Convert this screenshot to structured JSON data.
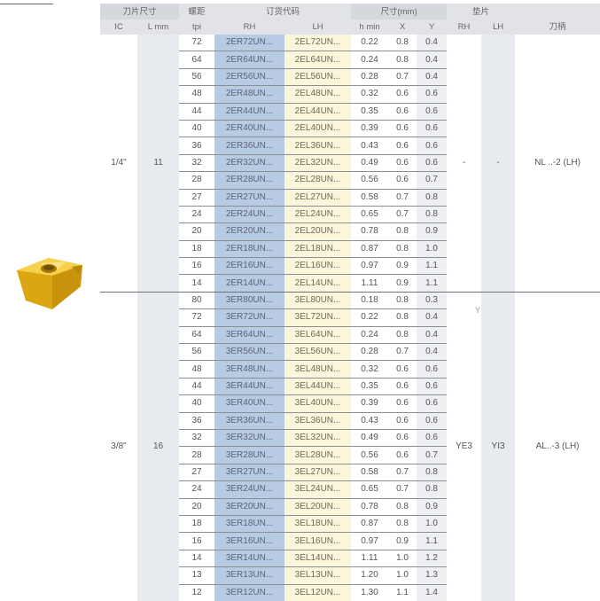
{
  "header": {
    "row1": {
      "insert_size": "刀片尺寸",
      "pitch": "螺距",
      "order_code": "订货代码",
      "dims": "尺寸(mm)",
      "shim": "垫片"
    },
    "row2": {
      "ic": "IC",
      "l": "L mm",
      "tpi": "tpi",
      "rh": "RH",
      "lh": "LH",
      "hmin": "h min",
      "x": "X",
      "y": "Y",
      "shim_rh": "RH",
      "shim_lh": "LH",
      "holder": "刀柄"
    }
  },
  "groups": [
    {
      "ic": "1/4\"",
      "l": "11",
      "shim_rh": "-",
      "shim_lh": "-",
      "holder": "NL ..-2 (LH)",
      "rows": [
        {
          "tpi": "72",
          "rh": "2ER72UN...",
          "lh": "2EL72UN...",
          "h": "0.22",
          "x": "0.8",
          "y": "0.4"
        },
        {
          "tpi": "64",
          "rh": "2ER64UN...",
          "lh": "2EL64UN...",
          "h": "0.24",
          "x": "0.8",
          "y": "0.4"
        },
        {
          "tpi": "56",
          "rh": "2ER56UN...",
          "lh": "2EL56UN...",
          "h": "0.28",
          "x": "0.7",
          "y": "0.4"
        },
        {
          "tpi": "48",
          "rh": "2ER48UN...",
          "lh": "2EL48UN...",
          "h": "0.32",
          "x": "0.6",
          "y": "0.6"
        },
        {
          "tpi": "44",
          "rh": "2ER44UN...",
          "lh": "2EL44UN...",
          "h": "0.35",
          "x": "0.6",
          "y": "0.6"
        },
        {
          "tpi": "40",
          "rh": "2ER40UN...",
          "lh": "2EL40UN...",
          "h": "0.39",
          "x": "0.6",
          "y": "0.6"
        },
        {
          "tpi": "36",
          "rh": "2ER36UN...",
          "lh": "2EL36UN...",
          "h": "0.43",
          "x": "0.6",
          "y": "0.6"
        },
        {
          "tpi": "32",
          "rh": "2ER32UN...",
          "lh": "2EL32UN...",
          "h": "0.49",
          "x": "0.6",
          "y": "0.6"
        },
        {
          "tpi": "28",
          "rh": "2ER28UN...",
          "lh": "2EL28UN...",
          "h": "0.56",
          "x": "0.6",
          "y": "0.7"
        },
        {
          "tpi": "27",
          "rh": "2ER27UN...",
          "lh": "2EL27UN...",
          "h": "0.58",
          "x": "0.7",
          "y": "0.8"
        },
        {
          "tpi": "24",
          "rh": "2ER24UN...",
          "lh": "2EL24UN...",
          "h": "0.65",
          "x": "0.7",
          "y": "0.8"
        },
        {
          "tpi": "20",
          "rh": "2ER20UN...",
          "lh": "2EL20UN...",
          "h": "0.78",
          "x": "0.8",
          "y": "0.9"
        },
        {
          "tpi": "18",
          "rh": "2ER18UN...",
          "lh": "2EL18UN...",
          "h": "0.87",
          "x": "0.8",
          "y": "1.0"
        },
        {
          "tpi": "16",
          "rh": "2ER16UN...",
          "lh": "2EL16UN...",
          "h": "0.97",
          "x": "0.9",
          "y": "1.1"
        },
        {
          "tpi": "14",
          "rh": "2ER14UN...",
          "lh": "2EL14UN...",
          "h": "1.11",
          "x": "0.9",
          "y": "1.1"
        }
      ]
    },
    {
      "ic": "3/8\"",
      "l": "16",
      "shim_rh": "YE3",
      "shim_lh": "YI3",
      "holder": "AL..-3 (LH)",
      "rows": [
        {
          "tpi": "80",
          "rh": "3ER80UN...",
          "lh": "3EL80UN...",
          "h": "0.18",
          "x": "0.8",
          "y": "0.3"
        },
        {
          "tpi": "72",
          "rh": "3ER72UN...",
          "lh": "3EL72UN...",
          "h": "0.22",
          "x": "0.8",
          "y": "0.4"
        },
        {
          "tpi": "64",
          "rh": "3ER64UN...",
          "lh": "3EL64UN...",
          "h": "0.24",
          "x": "0.8",
          "y": "0.4"
        },
        {
          "tpi": "56",
          "rh": "3ER56UN...",
          "lh": "3EL56UN...",
          "h": "0.28",
          "x": "0.7",
          "y": "0.4"
        },
        {
          "tpi": "48",
          "rh": "3ER48UN...",
          "lh": "3EL48UN...",
          "h": "0.32",
          "x": "0.6",
          "y": "0.6"
        },
        {
          "tpi": "44",
          "rh": "3ER44UN...",
          "lh": "3EL44UN...",
          "h": "0.35",
          "x": "0.6",
          "y": "0.6"
        },
        {
          "tpi": "40",
          "rh": "3ER40UN...",
          "lh": "3EL40UN...",
          "h": "0.39",
          "x": "0.6",
          "y": "0.6"
        },
        {
          "tpi": "36",
          "rh": "3ER36UN...",
          "lh": "3EL36UN...",
          "h": "0.43",
          "x": "0.6",
          "y": "0.6"
        },
        {
          "tpi": "32",
          "rh": "3ER32UN...",
          "lh": "3EL32UN...",
          "h": "0.49",
          "x": "0.6",
          "y": "0.6"
        },
        {
          "tpi": "28",
          "rh": "3ER28UN...",
          "lh": "3EL28UN...",
          "h": "0.56",
          "x": "0.6",
          "y": "0.7"
        },
        {
          "tpi": "27",
          "rh": "3ER27UN...",
          "lh": "3EL27UN...",
          "h": "0.58",
          "x": "0.7",
          "y": "0.8"
        },
        {
          "tpi": "24",
          "rh": "3ER24UN...",
          "lh": "3EL24UN...",
          "h": "0.65",
          "x": "0.7",
          "y": "0.8"
        },
        {
          "tpi": "20",
          "rh": "3ER20UN...",
          "lh": "3EL20UN...",
          "h": "0.78",
          "x": "0.8",
          "y": "0.9"
        },
        {
          "tpi": "18",
          "rh": "3ER18UN...",
          "lh": "3EL18UN...",
          "h": "0.87",
          "x": "0.8",
          "y": "1.0"
        },
        {
          "tpi": "16",
          "rh": "3ER16UN...",
          "lh": "3EL16UN...",
          "h": "0.97",
          "x": "0.9",
          "y": "1.1"
        },
        {
          "tpi": "14",
          "rh": "3ER14UN...",
          "lh": "3EL14UN...",
          "h": "1.11",
          "x": "1.0",
          "y": "1.2"
        },
        {
          "tpi": "13",
          "rh": "3ER13UN...",
          "lh": "3EL13UN...",
          "h": "1.20",
          "x": "1.0",
          "y": "1.3"
        },
        {
          "tpi": "12",
          "rh": "3ER12UN...",
          "lh": "3EL12UN...",
          "h": "1.30",
          "x": "1.1",
          "y": "1.4"
        }
      ]
    }
  ],
  "stray_mark": "Y",
  "colors": {
    "rh_column": "#b7cbe3",
    "lh_column": "#fbf6d9",
    "header_bg": "#e1e3e7",
    "insert_gold": "#e8b416"
  },
  "icons": {
    "insert": "threading-insert-icon"
  }
}
